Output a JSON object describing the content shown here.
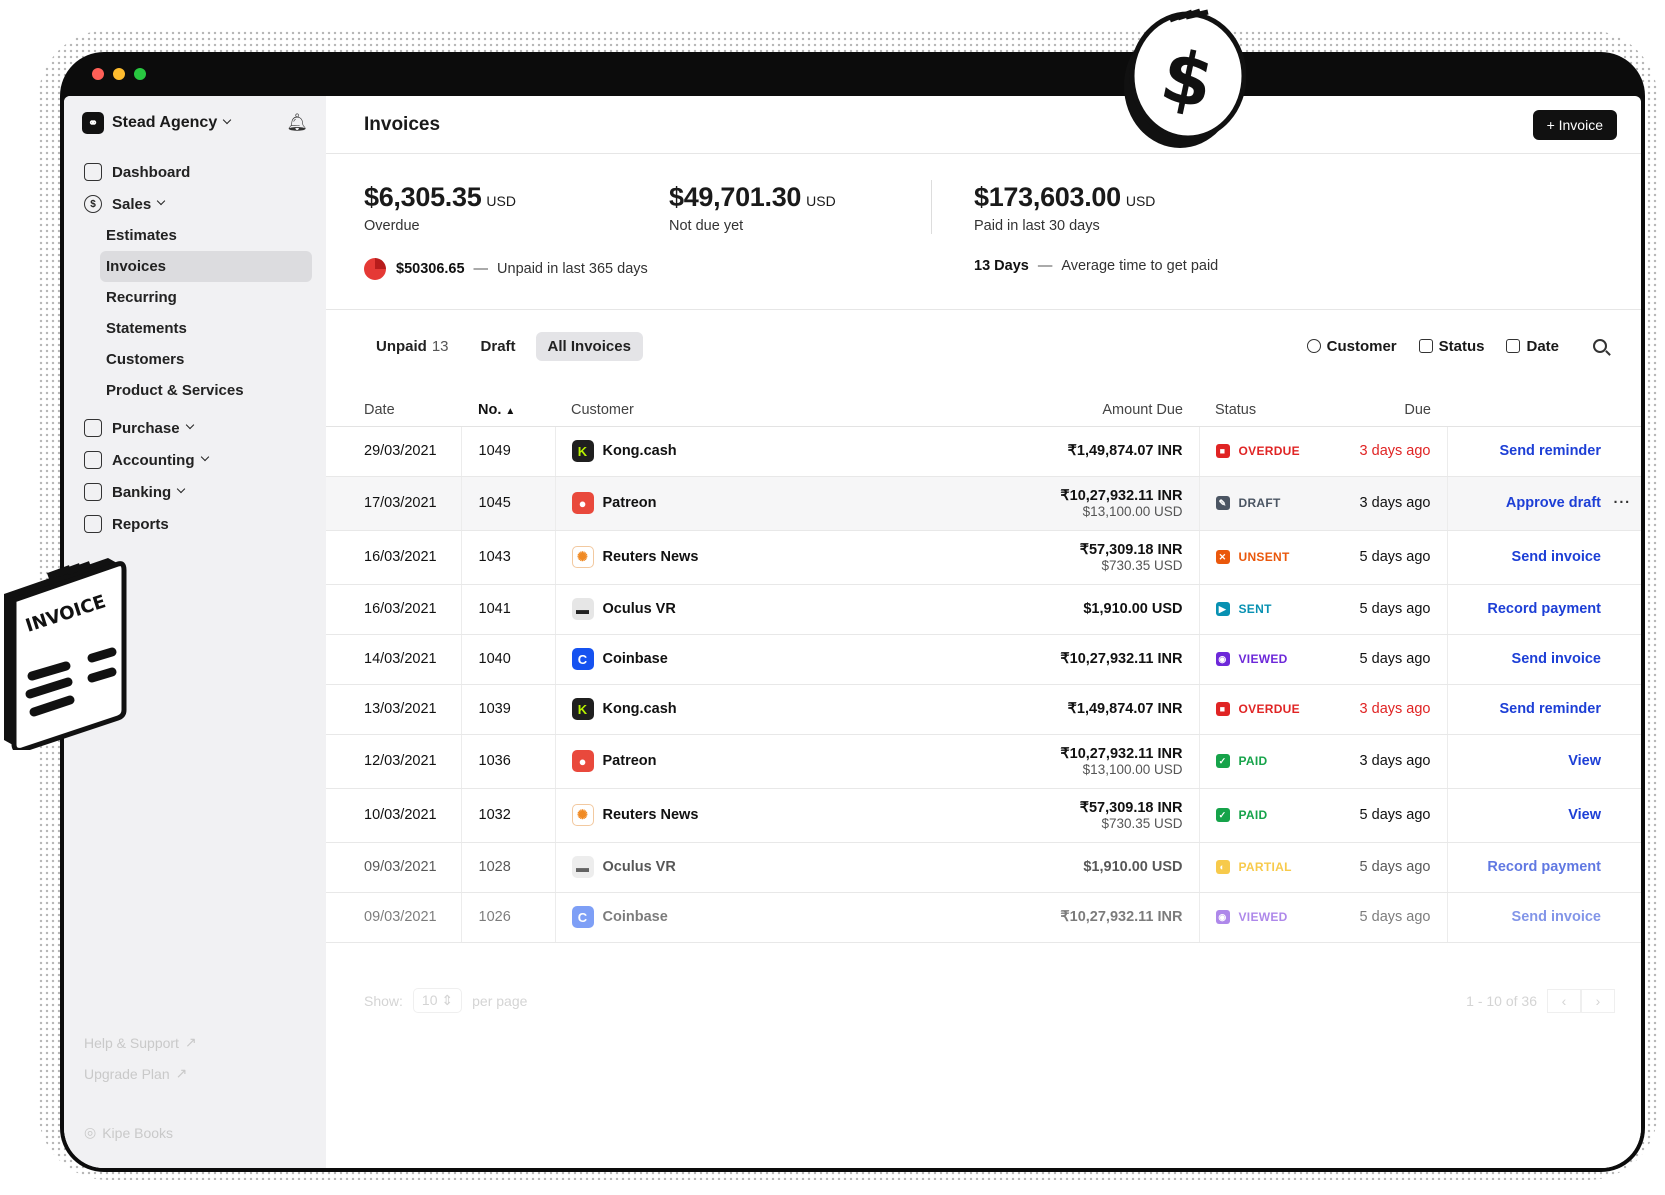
{
  "org": {
    "name": "Stead Agency"
  },
  "nav": {
    "dashboard": "Dashboard",
    "sales": "Sales",
    "sales_items": [
      "Estimates",
      "Invoices",
      "Recurring",
      "Statements",
      "Customers",
      "Product & Services"
    ],
    "purchase": "Purchase",
    "accounting": "Accounting",
    "banking": "Banking",
    "reports": "Reports"
  },
  "footer": {
    "help": "Help & Support",
    "upgrade": "Upgrade Plan",
    "brand": "Kipe Books"
  },
  "header": {
    "title": "Invoices",
    "new_button": "+ Invoice"
  },
  "stats": {
    "overdue": {
      "amount": "$6,305.35",
      "currency": "USD",
      "label": "Overdue"
    },
    "not_due": {
      "amount": "$49,701.30",
      "currency": "USD",
      "label": "Not due yet"
    },
    "paid": {
      "amount": "$173,603.00",
      "currency": "USD",
      "label": "Paid in last 30 days"
    },
    "unpaid_year": {
      "amount": "$50306.65",
      "label": "Unpaid in last 365 days"
    },
    "avg_time": {
      "value": "13 Days",
      "label": "Average time to get paid"
    }
  },
  "tabs": {
    "unpaid": "Unpaid",
    "unpaid_count": "13",
    "draft": "Draft",
    "all": "All Invoices"
  },
  "filters": {
    "customer": "Customer",
    "status": "Status",
    "date": "Date"
  },
  "columns": {
    "date": "Date",
    "no": "No.",
    "customer": "Customer",
    "amount": "Amount Due",
    "status": "Status",
    "due": "Due"
  },
  "rows": [
    {
      "date": "29/03/2021",
      "no": "1049",
      "customer": "Kong.cash",
      "amount": "₹1,49,874.07 INR",
      "amount_sub": "",
      "status": "OVERDUE",
      "due": "3 days ago",
      "action": "Send reminder"
    },
    {
      "date": "17/03/2021",
      "no": "1045",
      "customer": "Patreon",
      "amount": "₹10,27,932.11 INR",
      "amount_sub": "$13,100.00 USD",
      "status": "DRAFT",
      "due": "3 days ago",
      "action": "Approve draft"
    },
    {
      "date": "16/03/2021",
      "no": "1043",
      "customer": "Reuters News",
      "amount": "₹57,309.18 INR",
      "amount_sub": "$730.35 USD",
      "status": "UNSENT",
      "due": "5 days ago",
      "action": "Send invoice"
    },
    {
      "date": "16/03/2021",
      "no": "1041",
      "customer": "Oculus VR",
      "amount": "$1,910.00 USD",
      "amount_sub": "",
      "status": "SENT",
      "due": "5 days ago",
      "action": "Record payment"
    },
    {
      "date": "14/03/2021",
      "no": "1040",
      "customer": "Coinbase",
      "amount": "₹10,27,932.11 INR",
      "amount_sub": "",
      "status": "VIEWED",
      "due": "5 days ago",
      "action": "Send invoice"
    },
    {
      "date": "13/03/2021",
      "no": "1039",
      "customer": "Kong.cash",
      "amount": "₹1,49,874.07 INR",
      "amount_sub": "",
      "status": "OVERDUE",
      "due": "3 days ago",
      "action": "Send reminder"
    },
    {
      "date": "12/03/2021",
      "no": "1036",
      "customer": "Patreon",
      "amount": "₹10,27,932.11 INR",
      "amount_sub": "$13,100.00 USD",
      "status": "PAID",
      "due": "3 days ago",
      "action": "View"
    },
    {
      "date": "10/03/2021",
      "no": "1032",
      "customer": "Reuters News",
      "amount": "₹57,309.18 INR",
      "amount_sub": "$730.35 USD",
      "status": "PAID",
      "due": "5 days ago",
      "action": "View"
    },
    {
      "date": "09/03/2021",
      "no": "1028",
      "customer": "Oculus VR",
      "amount": "$1,910.00 USD",
      "amount_sub": "",
      "status": "PARTIAL",
      "due": "5 days ago",
      "action": "Record payment"
    },
    {
      "date": "09/03/2021",
      "no": "1026",
      "customer": "Coinbase",
      "amount": "₹10,27,932.11 INR",
      "amount_sub": "",
      "status": "VIEWED",
      "due": "5 days ago",
      "action": "Send invoice"
    }
  ],
  "pager": {
    "show_label": "Show:",
    "per_page_value": "10",
    "per_page_label": "per page",
    "range": "1 - 10 of 36"
  },
  "decor": {
    "coin_symbol": "$",
    "badge_text": "INVOICE"
  },
  "colors": {
    "overdue": "#e02424",
    "draft": "#4b5563",
    "unsent": "#ea580c",
    "sent": "#0891b2",
    "viewed": "#6d28d9",
    "paid": "#16a34a",
    "partial": "#f5b400",
    "link": "#1d3fd6"
  }
}
